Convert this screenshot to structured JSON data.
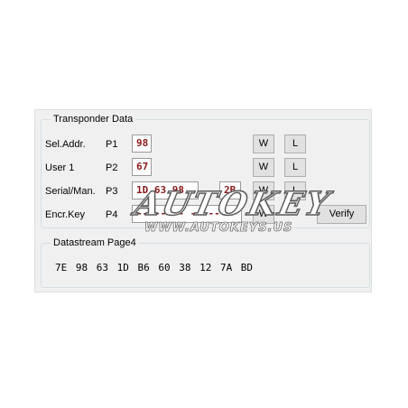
{
  "transponder": {
    "title": "Transponder Data",
    "rows": [
      {
        "name": "Sel.Addr.",
        "page": "P1",
        "value": "98",
        "w": "W",
        "l": "L"
      },
      {
        "name": "User 1",
        "page": "P2",
        "value": "67",
        "w": "W",
        "l": "L"
      },
      {
        "name": "Serial/Man.",
        "page": "P3",
        "value": "1D 63 98",
        "extra": "2B",
        "w": "W",
        "l": "L"
      },
      {
        "name": "Encr.Key",
        "page": "P4",
        "value": "-- -- -- -- -- --",
        "w": "W",
        "verify": "Verify"
      }
    ]
  },
  "datastream": {
    "title": "Datastream Page4",
    "bytes": "7E 98 63 1D B6 60 38 12 7A BD"
  },
  "watermark": {
    "brand": "AUTOKEY",
    "url": "WWW.AUTOKEYS.US"
  },
  "colors": {
    "field_text": "#8b1a1a",
    "panel_bg": "#f0f0f0"
  }
}
